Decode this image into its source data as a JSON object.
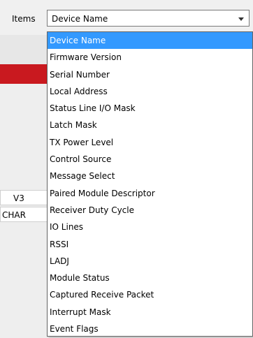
{
  "items_label": "Items",
  "combo": {
    "value": "Device Name"
  },
  "left_cells": [
    "V3",
    "CHAR"
  ],
  "dropdown_options": [
    "Device Name",
    "Firmware Version",
    "Serial Number",
    "Local Address",
    "Status Line I/O Mask",
    "Latch Mask",
    "TX Power Level",
    "Control Source",
    "Message Select",
    "Paired Module Descriptor",
    "Receiver Duty Cycle",
    "IO Lines",
    "RSSI",
    "LADJ",
    "Module Status",
    "Captured Receive Packet",
    "Interrupt Mask",
    "Event Flags"
  ],
  "selected_index": 0,
  "colors": {
    "highlight": "#3399ff",
    "red_bar": "#c9191f"
  }
}
